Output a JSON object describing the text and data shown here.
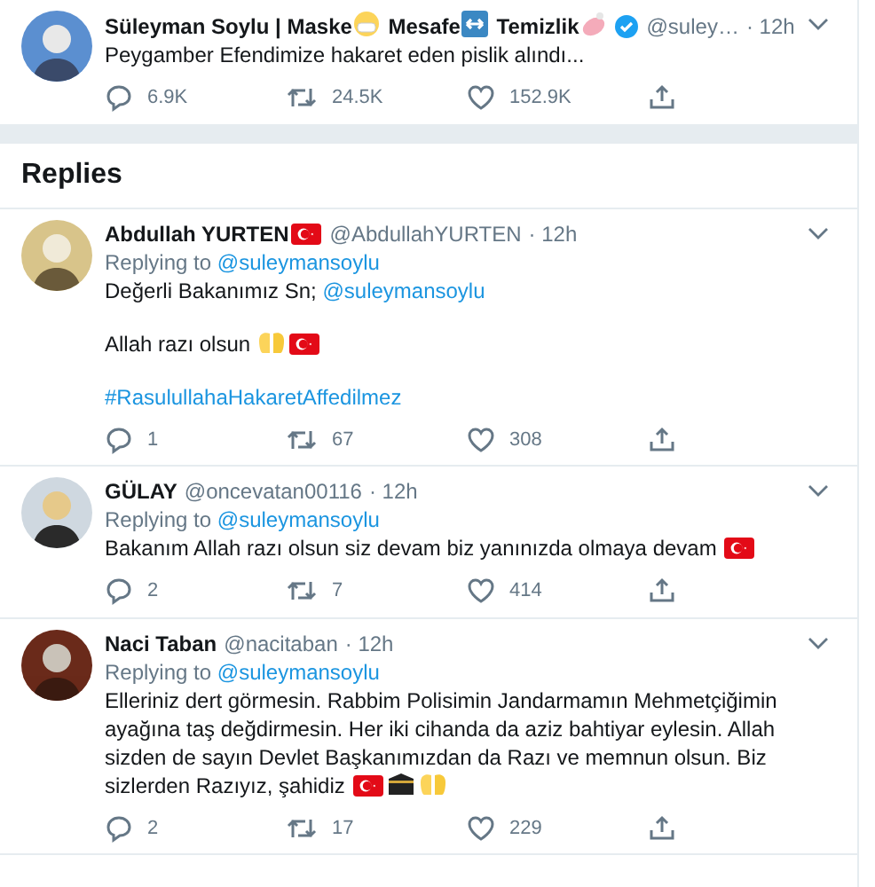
{
  "main_tweet": {
    "name": [
      {
        "kind": "text",
        "text": "Süleyman Soylu | Maske"
      },
      {
        "kind": "mask"
      },
      {
        "kind": "text",
        "text": " Mesafe"
      },
      {
        "kind": "arrows"
      },
      {
        "kind": "text",
        "text": " Temizlik"
      },
      {
        "kind": "soap"
      }
    ],
    "verified": true,
    "handle": "@suley…",
    "time": "· 12h",
    "avatar": {
      "kind": "picture"
    },
    "body": [
      {
        "segments": [
          {
            "kind": "text",
            "text": "Peygamber Efendimize hakaret eden pislik alındı..."
          }
        ]
      }
    ],
    "actions": [
      {
        "kind": "reply",
        "count": "6.9K"
      },
      {
        "kind": "retweet",
        "count": "24.5K"
      },
      {
        "kind": "like",
        "count": "152.9K"
      },
      {
        "kind": "share"
      }
    ]
  },
  "replies_heading": "Replies",
  "replies": [
    {
      "name": [
        {
          "kind": "text",
          "text": "Abdullah YURTEN"
        },
        {
          "kind": "flag"
        }
      ],
      "handle": "@AbdullahYURTEN",
      "time": "· 12h",
      "replying_label": "Replying to",
      "replying_to": "@suleymansoylu",
      "avatar": {
        "kind": "picture"
      },
      "body": [
        {
          "segments": [
            {
              "kind": "text",
              "text": "Değerli Bakanımız Sn; "
            },
            {
              "kind": "mention",
              "text": "@suleymansoylu"
            }
          ]
        },
        {
          "segments": [
            {
              "kind": "text",
              "text": "Allah razı olsun "
            },
            {
              "kind": "hands"
            },
            {
              "kind": "flag"
            }
          ]
        },
        {
          "segments": [
            {
              "kind": "hashtag",
              "text": "#RasulullahaHakaretAffedilmez"
            }
          ]
        }
      ],
      "actions": [
        {
          "kind": "reply",
          "count": "1"
        },
        {
          "kind": "retweet",
          "count": "67"
        },
        {
          "kind": "like",
          "count": "308"
        },
        {
          "kind": "share"
        }
      ]
    },
    {
      "name": [
        {
          "kind": "text",
          "text": "GÜLAY"
        }
      ],
      "handle": "@oncevatan00116",
      "time": "· 12h",
      "replying_label": "Replying to",
      "replying_to": "@suleymansoylu",
      "avatar": {
        "kind": "picture"
      },
      "body": [
        {
          "segments": [
            {
              "kind": "text",
              "text": "Bakanım Allah razı olsun siz devam biz yanınızda olmaya devam "
            },
            {
              "kind": "flag"
            }
          ]
        }
      ],
      "actions": [
        {
          "kind": "reply",
          "count": "2"
        },
        {
          "kind": "retweet",
          "count": "7"
        },
        {
          "kind": "like",
          "count": "414"
        },
        {
          "kind": "share"
        }
      ]
    },
    {
      "name": [
        {
          "kind": "text",
          "text": "Naci Taban"
        }
      ],
      "handle": "@nacitaban",
      "time": "· 12h",
      "replying_label": "Replying to",
      "replying_to": "@suleymansoylu",
      "avatar": {
        "kind": "picture"
      },
      "body": [
        {
          "segments": [
            {
              "kind": "text",
              "text": "Elleriniz dert görmesin. Rabbim Polisimin Jandarmamın Mehmetçiğimin ayağına taş değdirmesin. Her iki cihanda da aziz bahtiyar eylesin. Allah sizden de sayın Devlet Başkanımızdan da Razı ve memnun olsun. Biz sizlerden Razıyız, şahidiz "
            },
            {
              "kind": "flag"
            },
            {
              "kind": "kaaba"
            },
            {
              "kind": "hands"
            }
          ]
        }
      ],
      "actions": [
        {
          "kind": "reply",
          "count": "2"
        },
        {
          "kind": "retweet",
          "count": "17"
        },
        {
          "kind": "like",
          "count": "229"
        },
        {
          "kind": "share"
        }
      ]
    }
  ]
}
